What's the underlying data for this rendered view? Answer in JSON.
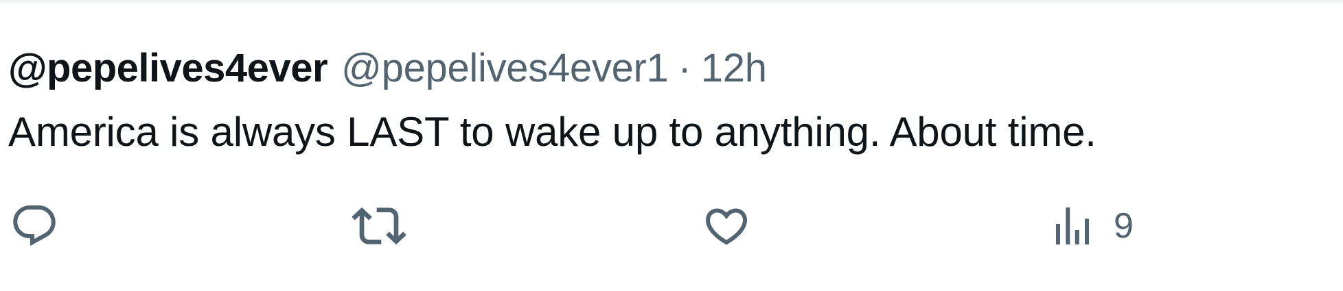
{
  "tweet": {
    "display_name": "@pepelives4ever",
    "handle": "@pepelives4ever1",
    "separator": "·",
    "time": "12h",
    "text": "America is always LAST to wake up to anything. About time."
  },
  "actions": {
    "reply": {
      "icon": "reply-icon"
    },
    "retweet": {
      "icon": "retweet-icon"
    },
    "like": {
      "icon": "heart-icon"
    },
    "views": {
      "icon": "views-icon",
      "count": "9"
    }
  },
  "colors": {
    "primary_text": "#0f1419",
    "secondary_text": "#536471",
    "border": "#eff3f4"
  }
}
